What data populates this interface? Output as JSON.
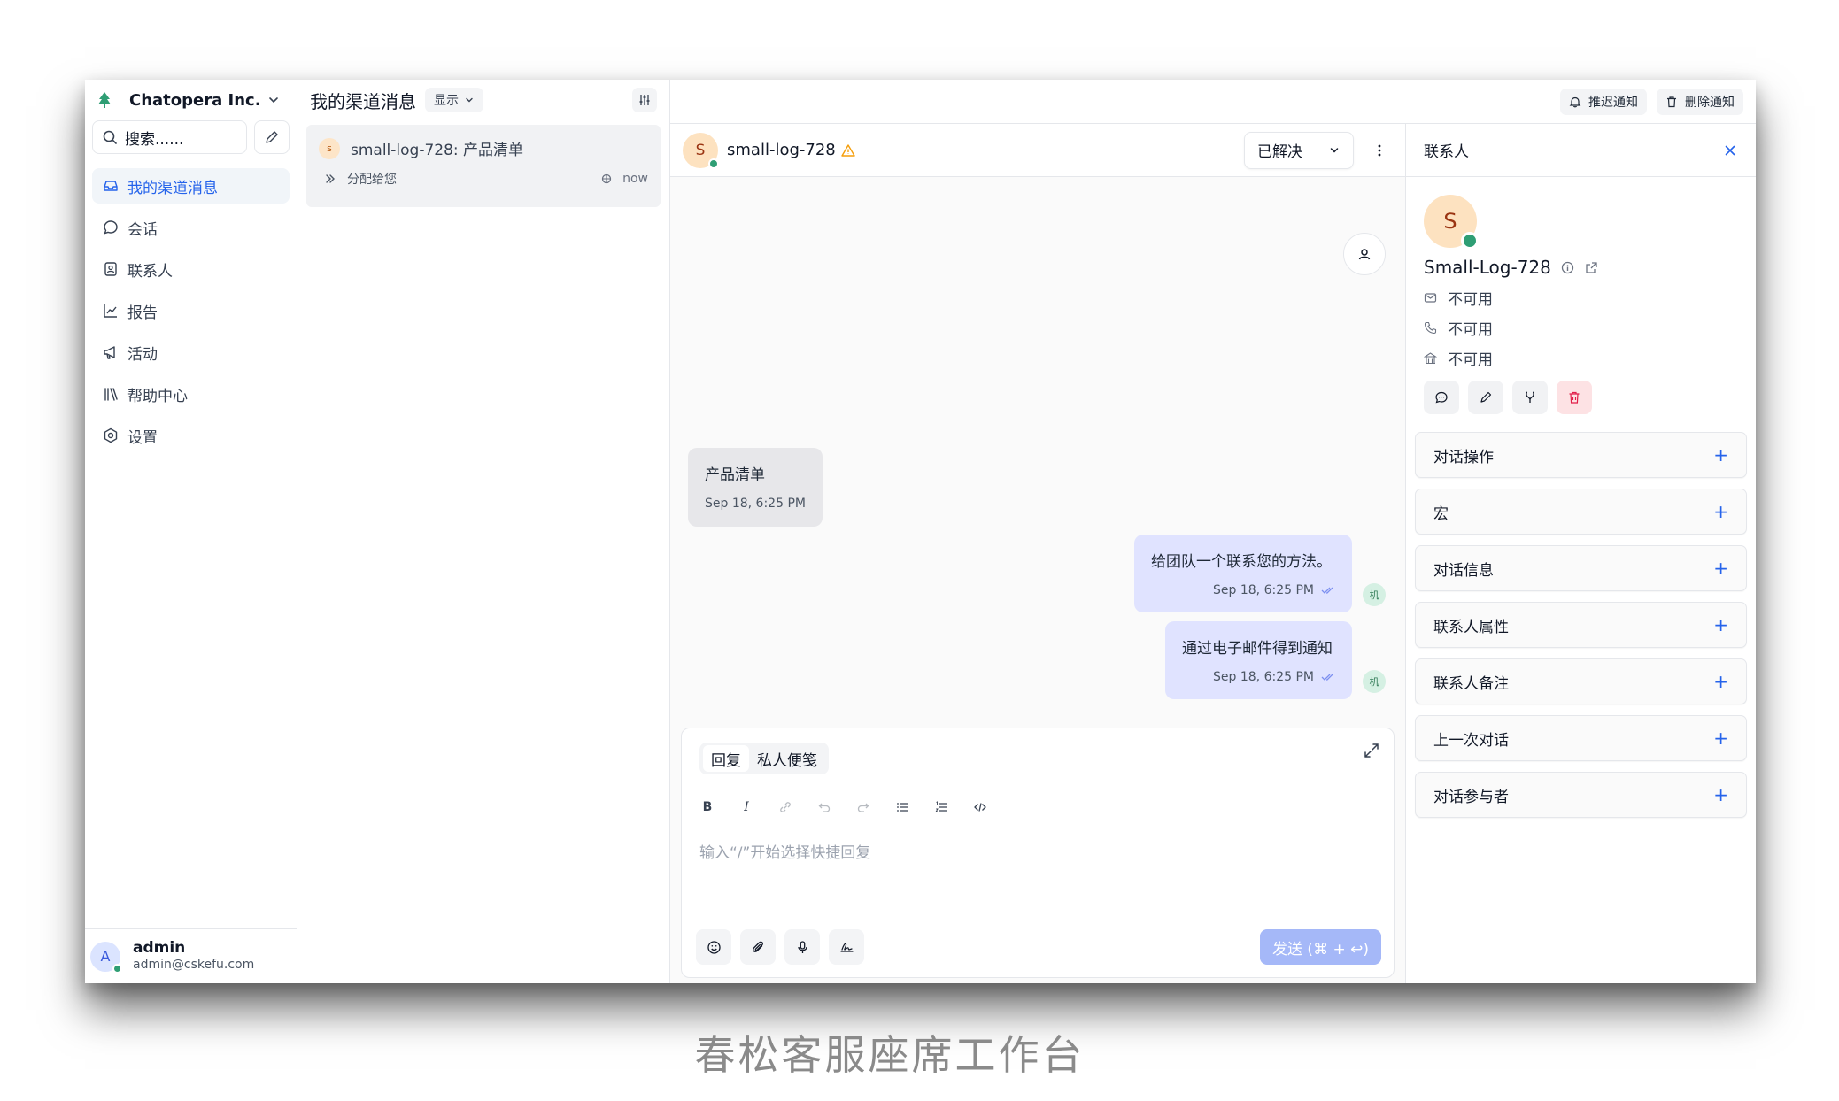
{
  "brand": {
    "name": "Chatopera Inc."
  },
  "search": {
    "placeholder": "搜索......"
  },
  "nav": [
    {
      "label": "我的渠道消息",
      "icon": "inbox-icon",
      "active": true
    },
    {
      "label": "会话",
      "icon": "chat-bubble-icon"
    },
    {
      "label": "联系人",
      "icon": "contact-card-icon"
    },
    {
      "label": "报告",
      "icon": "line-chart-icon"
    },
    {
      "label": "活动",
      "icon": "megaphone-icon"
    },
    {
      "label": "帮助中心",
      "icon": "library-icon"
    },
    {
      "label": "设置",
      "icon": "settings-icon"
    }
  ],
  "user": {
    "initial": "A",
    "name": "admin",
    "email": "admin@cskefu.com"
  },
  "convlist": {
    "title": "我的渠道消息",
    "display_label": "显示",
    "item": {
      "avatar": "s",
      "title": "small-log-728: 产品清单",
      "assigned": "分配给您",
      "time": "now"
    }
  },
  "topbar": {
    "snooze_label": "推迟通知",
    "delete_label": "删除通知"
  },
  "chat": {
    "avatar": "S",
    "name": "small-log-728",
    "status": "已解决",
    "messages": [
      {
        "direction": "in",
        "text": "产品清单",
        "time": "Sep 18, 6:25 PM"
      },
      {
        "direction": "out",
        "text": "给团队一个联系您的方法。",
        "time": "Sep 18, 6:25 PM",
        "sender": "机"
      },
      {
        "direction": "out",
        "text": "通过电子邮件得到通知",
        "time": "Sep 18, 6:25 PM",
        "sender": "机"
      }
    ]
  },
  "composer": {
    "tabs": [
      "回复",
      "私人便笺"
    ],
    "placeholder": "输入“/”开始选择快捷回复",
    "send_label": "发送 (⌘ + ↩)",
    "tools": [
      "B",
      "I"
    ]
  },
  "contact": {
    "header": "联系人",
    "avatar": "S",
    "name": "Small-Log-728",
    "email": "不可用",
    "phone": "不可用",
    "company": "不可用",
    "sections": [
      "对话操作",
      "宏",
      "对话信息",
      "联系人属性",
      "联系人备注",
      "上一次对话",
      "对话参与者"
    ],
    "plus": "+"
  },
  "caption": "春松客服座席工作台",
  "colors": {
    "accent": "#2563eb",
    "online": "#2f9e74",
    "outgoing_bubble": "#e0e3ff",
    "incoming_bubble": "#e7e7ea"
  }
}
